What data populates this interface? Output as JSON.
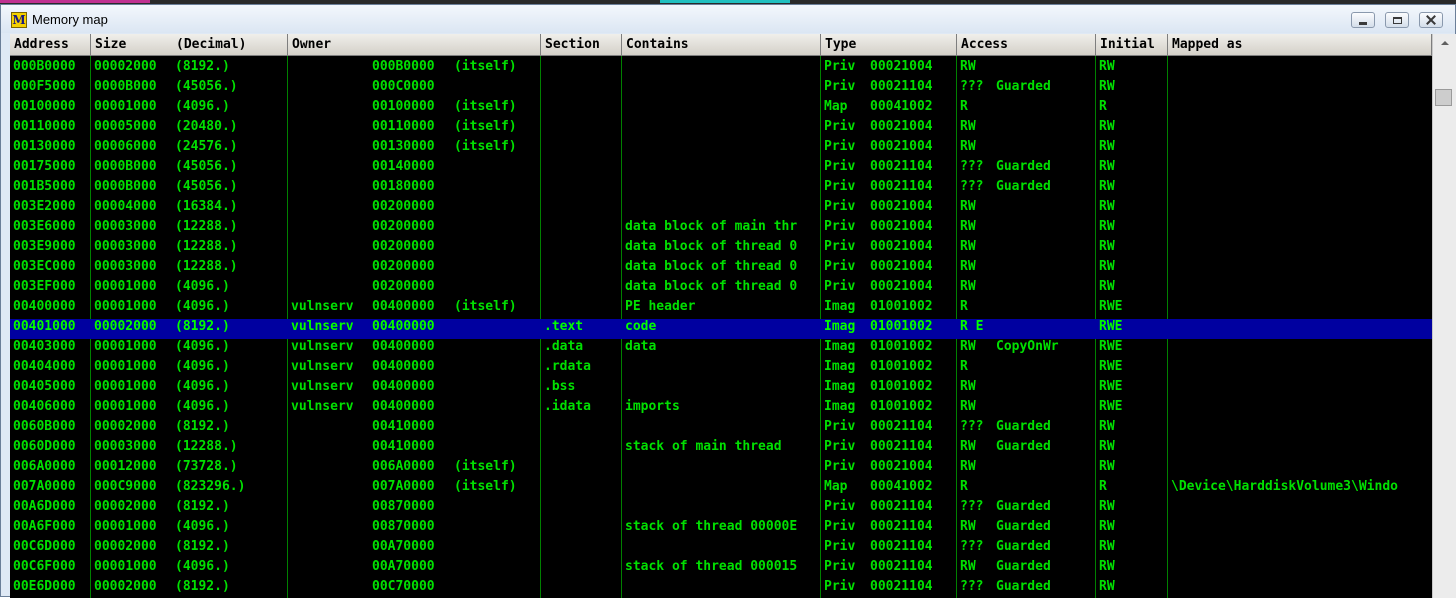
{
  "window": {
    "title": "Memory map",
    "app_icon_letter": "M"
  },
  "columns": [
    "Address",
    "Size",
    "(Decimal)",
    "Owner",
    "Section",
    "Contains",
    "Type",
    "Access",
    "Initial",
    "Mapped as"
  ],
  "rows": [
    [
      "000B0000",
      "00002000",
      "(8192.)",
      "",
      "000B0000",
      "(itself)",
      "",
      "",
      "Priv",
      "00021004",
      "RW",
      "",
      "RW",
      ""
    ],
    [
      "000F5000",
      "0000B000",
      "(45056.)",
      "",
      "000C0000",
      "",
      "",
      "",
      "Priv",
      "00021104",
      "???",
      "Guarded",
      "RW",
      ""
    ],
    [
      "00100000",
      "00001000",
      "(4096.)",
      "",
      "00100000",
      "(itself)",
      "",
      "",
      "Map",
      "00041002",
      "R",
      "",
      "R",
      ""
    ],
    [
      "00110000",
      "00005000",
      "(20480.)",
      "",
      "00110000",
      "(itself)",
      "",
      "",
      "Priv",
      "00021004",
      "RW",
      "",
      "RW",
      ""
    ],
    [
      "00130000",
      "00006000",
      "(24576.)",
      "",
      "00130000",
      "(itself)",
      "",
      "",
      "Priv",
      "00021004",
      "RW",
      "",
      "RW",
      ""
    ],
    [
      "00175000",
      "0000B000",
      "(45056.)",
      "",
      "00140000",
      "",
      "",
      "",
      "Priv",
      "00021104",
      "???",
      "Guarded",
      "RW",
      ""
    ],
    [
      "001B5000",
      "0000B000",
      "(45056.)",
      "",
      "00180000",
      "",
      "",
      "",
      "Priv",
      "00021104",
      "???",
      "Guarded",
      "RW",
      ""
    ],
    [
      "003E2000",
      "00004000",
      "(16384.)",
      "",
      "00200000",
      "",
      "",
      "",
      "Priv",
      "00021004",
      "RW",
      "",
      "RW",
      ""
    ],
    [
      "003E6000",
      "00003000",
      "(12288.)",
      "",
      "00200000",
      "",
      "",
      "data block of main thr",
      "Priv",
      "00021004",
      "RW",
      "",
      "RW",
      ""
    ],
    [
      "003E9000",
      "00003000",
      "(12288.)",
      "",
      "00200000",
      "",
      "",
      "data block of thread 0",
      "Priv",
      "00021004",
      "RW",
      "",
      "RW",
      ""
    ],
    [
      "003EC000",
      "00003000",
      "(12288.)",
      "",
      "00200000",
      "",
      "",
      "data block of thread 0",
      "Priv",
      "00021004",
      "RW",
      "",
      "RW",
      ""
    ],
    [
      "003EF000",
      "00001000",
      "(4096.)",
      "",
      "00200000",
      "",
      "",
      "data block of thread 0",
      "Priv",
      "00021004",
      "RW",
      "",
      "RW",
      ""
    ],
    [
      "00400000",
      "00001000",
      "(4096.)",
      "vulnserv",
      "00400000",
      "(itself)",
      "",
      "PE header",
      "Imag",
      "01001002",
      "R",
      "",
      "RWE",
      ""
    ],
    [
      "00401000",
      "00002000",
      "(8192.)",
      "vulnserv",
      "00400000",
      "",
      ".text",
      "code",
      "Imag",
      "01001002",
      "R E",
      "",
      "RWE",
      ""
    ],
    [
      "00403000",
      "00001000",
      "(4096.)",
      "vulnserv",
      "00400000",
      "",
      ".data",
      "data",
      "Imag",
      "01001002",
      "RW",
      "CopyOnWr",
      "RWE",
      ""
    ],
    [
      "00404000",
      "00001000",
      "(4096.)",
      "vulnserv",
      "00400000",
      "",
      ".rdata",
      "",
      "Imag",
      "01001002",
      "R",
      "",
      "RWE",
      ""
    ],
    [
      "00405000",
      "00001000",
      "(4096.)",
      "vulnserv",
      "00400000",
      "",
      ".bss",
      "",
      "Imag",
      "01001002",
      "RW",
      "",
      "RWE",
      ""
    ],
    [
      "00406000",
      "00001000",
      "(4096.)",
      "vulnserv",
      "00400000",
      "",
      ".idata",
      "imports",
      "Imag",
      "01001002",
      "RW",
      "",
      "RWE",
      ""
    ],
    [
      "0060B000",
      "00002000",
      "(8192.)",
      "",
      "00410000",
      "",
      "",
      "",
      "Priv",
      "00021104",
      "???",
      "Guarded",
      "RW",
      ""
    ],
    [
      "0060D000",
      "00003000",
      "(12288.)",
      "",
      "00410000",
      "",
      "",
      "stack of main thread",
      "Priv",
      "00021104",
      "RW",
      "Guarded",
      "RW",
      ""
    ],
    [
      "006A0000",
      "00012000",
      "(73728.)",
      "",
      "006A0000",
      "(itself)",
      "",
      "",
      "Priv",
      "00021004",
      "RW",
      "",
      "RW",
      ""
    ],
    [
      "007A0000",
      "000C9000",
      "(823296.)",
      "",
      "007A0000",
      "(itself)",
      "",
      "",
      "Map",
      "00041002",
      "R",
      "",
      "R",
      "\\Device\\HarddiskVolume3\\Windo"
    ],
    [
      "00A6D000",
      "00002000",
      "(8192.)",
      "",
      "00870000",
      "",
      "",
      "",
      "Priv",
      "00021104",
      "???",
      "Guarded",
      "RW",
      ""
    ],
    [
      "00A6F000",
      "00001000",
      "(4096.)",
      "",
      "00870000",
      "",
      "",
      "stack of thread 00000E",
      "Priv",
      "00021104",
      "RW",
      "Guarded",
      "RW",
      ""
    ],
    [
      "00C6D000",
      "00002000",
      "(8192.)",
      "",
      "00A70000",
      "",
      "",
      "",
      "Priv",
      "00021104",
      "???",
      "Guarded",
      "RW",
      ""
    ],
    [
      "00C6F000",
      "00001000",
      "(4096.)",
      "",
      "00A70000",
      "",
      "",
      "stack of thread 000015",
      "Priv",
      "00021104",
      "RW",
      "Guarded",
      "RW",
      ""
    ],
    [
      "00E6D000",
      "00002000",
      "(8192.)",
      "",
      "00C70000",
      "",
      "",
      "",
      "Priv",
      "00021104",
      "???",
      "Guarded",
      "RW",
      ""
    ]
  ],
  "selected_row": 13,
  "colors": {
    "row_text": "#00e000",
    "selected_bg": "#0000a0",
    "grid_line": "#008000",
    "table_bg": "#000000"
  },
  "icons": {
    "minimize": "minimize-icon",
    "maximize": "maximize-icon",
    "close": "close-icon",
    "scroll_up": "arrow-up-icon"
  }
}
